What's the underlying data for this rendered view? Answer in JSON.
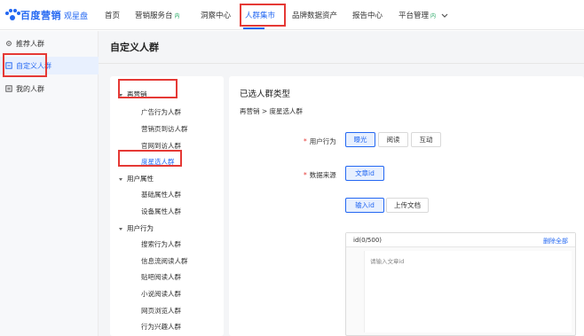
{
  "brand": {
    "name": "百度营销",
    "sub": "观星盘"
  },
  "topnav": [
    {
      "label": "首页"
    },
    {
      "label": "营销服务台",
      "badge": "内"
    },
    {
      "label": "洞察中心"
    },
    {
      "label": "人群集市",
      "active": true
    },
    {
      "label": "品牌数据资产"
    },
    {
      "label": "报告中心"
    },
    {
      "label": "平台管理",
      "badge": "内"
    }
  ],
  "sidebar": {
    "items": [
      {
        "label": "推荐人群",
        "icon": "gear-icon"
      },
      {
        "label": "自定义人群",
        "icon": "custom-group-icon",
        "active": true
      },
      {
        "label": "我的人群",
        "icon": "list-icon"
      }
    ]
  },
  "page": {
    "title": "自定义人群"
  },
  "tree": {
    "groups": [
      {
        "label": "再营销",
        "children": [
          "广告行为人群",
          "营销页到访人群",
          "官网到访人群",
          "度星选人群"
        ]
      },
      {
        "label": "用户属性",
        "children": [
          "基础属性人群",
          "设备属性人群"
        ]
      },
      {
        "label": "用户行为",
        "children": [
          "搜索行为人群",
          "信息流阅读人群",
          "贴吧阅读人群",
          "小说阅读人群",
          "网页浏览人群",
          "行为兴趣人群"
        ]
      }
    ],
    "selected": "度星选人群"
  },
  "form": {
    "title": "已选人群类型",
    "breadcrumb": "再营销 > 度星选人群",
    "behavior": {
      "label": "用户行为",
      "options": [
        "曝光",
        "阅读",
        "互动"
      ],
      "selected": "曝光"
    },
    "source": {
      "label": "数据来源",
      "options": [
        "文章id"
      ],
      "selected": "文章id"
    },
    "input_mode": {
      "options": [
        "输入id",
        "上传文档"
      ],
      "selected": "输入id"
    },
    "textarea": {
      "count": "id(0/500)",
      "clear_label": "删除全部",
      "placeholder": "请输入文章id"
    }
  },
  "colors": {
    "accent": "#2468f2",
    "highlight": "#e53935",
    "badge": "#1aa35b"
  }
}
